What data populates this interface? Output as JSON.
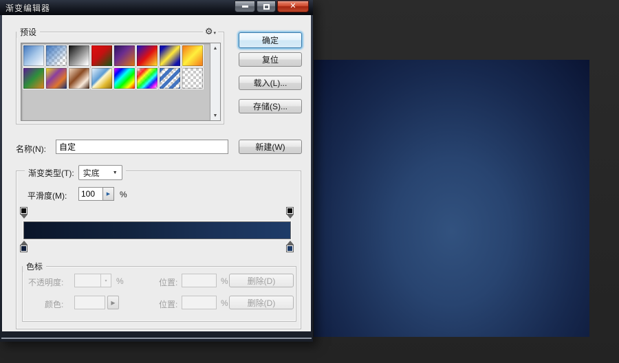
{
  "window": {
    "title": "渐变编辑器",
    "minimize_icon": "",
    "maximize_icon": "",
    "close_icon": "✕"
  },
  "background": {
    "canvas_css": "radial-gradient(ellipse at 50% 62%, #32527f 0%, #284470 30%, #17294f 66%, #0a1433 100%)"
  },
  "presets": {
    "label": "预设",
    "gear_icon": "⚙",
    "gear_menu_arrow": "▾",
    "scroll_up_icon": "▲",
    "scroll_down_icon": "▼",
    "items": [
      {
        "id": "fg-to-bg",
        "css": "linear-gradient(135deg,#3d74bd 0%,#a6c6e8 50%,#ffffff 100%)"
      },
      {
        "id": "fg-to-transparent",
        "css": "linear-gradient(135deg,rgba(61,116,189,1) 0%,rgba(97,146,205,0.6) 45%,rgba(255,255,255,0) 80%),linear-gradient(45deg,#c9c9c9 25%,transparent 25%,transparent 75%,#c9c9c9 75%) 0 0/8px 8px,linear-gradient(45deg,#c9c9c9 25%,transparent 25%,transparent 75%,#c9c9c9 75%) 4px 4px/8px 8px,#fff"
      },
      {
        "id": "black-to-white",
        "css": "linear-gradient(135deg,#0a0a0a 0%,#f8f8f8 90%)"
      },
      {
        "id": "red-to-green",
        "css": "linear-gradient(135deg,#e30e0e 0%,#c41111 45%,#0f5a14 100%)"
      },
      {
        "id": "violet-to-orange",
        "css": "linear-gradient(135deg,#27135f 0%,#6b2d8f 40%,#e0760f 100%)"
      },
      {
        "id": "blue-red-yellow",
        "css": "linear-gradient(135deg,#1212c8 0%,#e01111 52%,#ffec30 100%)"
      },
      {
        "id": "blue-yellow-blue",
        "css": "linear-gradient(135deg,#1111ae 15%,#ffe83a 50%,#1111ae 85%)"
      },
      {
        "id": "orange-yellow-orange",
        "css": "linear-gradient(135deg,#f68b1f 10%,#ffef3c 50%,#f68b1f 90%)"
      },
      {
        "id": "violet-green-orange",
        "css": "linear-gradient(135deg,#5c1a96 0%,#2e8f3c 50%,#e0821c 100%)"
      },
      {
        "id": "yellow-violet-orange-blue",
        "css": "linear-gradient(135deg,#f2df1d 0%,#8a3f9e 38%,#df752c 68%,#123079 100%)"
      },
      {
        "id": "copper",
        "css": "linear-gradient(135deg,#f6dfc9 0%,#8c4c24 42%,#f9e9da 72%,#401f0e 100%)"
      },
      {
        "id": "chrome",
        "css": "linear-gradient(135deg,#edf6fe 0%,#5c9cd4 42%,#fdf7d0 50%,#e3bb32 72%,#8f6c10 100%)"
      },
      {
        "id": "spectrum",
        "css": "linear-gradient(135deg,#ff00ff 0%,#0000ff 20%,#00ffff 40%,#00ff00 60%,#ffff00 80%,#ff0000 100%)"
      },
      {
        "id": "transparent-rainbow",
        "css": "linear-gradient(135deg,rgba(255,255,255,0) 2%,rgba(255,0,0,0.85) 22%,rgba(255,255,0,0.85) 36%,rgba(0,255,0,0.85) 50%,rgba(0,255,255,0.85) 62%,rgba(0,0,255,0.85) 74%,rgba(255,0,255,0.85) 86%,rgba(255,255,255,0) 98%),linear-gradient(45deg,#c9c9c9 25%,transparent 25%,transparent 75%,#c9c9c9 75%) 0 0/8px 8px,linear-gradient(45deg,#c9c9c9 25%,transparent 25%,transparent 75%,#c9c9c9 75%) 4px 4px/8px 8px,#fff"
      },
      {
        "id": "transparent-stripes",
        "css": "repeating-linear-gradient(135deg,rgba(58,110,190,0.95) 0px,rgba(58,110,190,0.95) 5px,rgba(255,255,255,0) 5px,rgba(255,255,255,0) 10px),linear-gradient(45deg,#c9c9c9 25%,transparent 25%,transparent 75%,#c9c9c9 75%) 0 0/8px 8px,linear-gradient(45deg,#c9c9c9 25%,transparent 25%,transparent 75%,#c9c9c9 75%) 4px 4px/8px 8px,#fff"
      },
      {
        "id": "noise-sample",
        "css": "linear-gradient(45deg,#c9c9c9 25%,transparent 25%,transparent 75%,#c9c9c9 75%) 0 0/8px 8px,linear-gradient(45deg,#c9c9c9 25%,transparent 25%,transparent 75%,#c9c9c9 75%) 4px 4px/8px 8px,#fff"
      }
    ]
  },
  "actions": {
    "ok": "确定",
    "reset": "复位",
    "load": "载入(L)...",
    "save": "存储(S)..."
  },
  "name_row": {
    "label": "名称(N):",
    "value": "自定",
    "new_button": "新建(W)"
  },
  "gradient": {
    "type_label": "渐变类型(T):",
    "type_value": "实底",
    "type_dropdown_icon": "▼",
    "smooth_label": "平滑度(M):",
    "smooth_value": "100",
    "smooth_spin_icon": "▶",
    "percent": "%",
    "bar_css": "linear-gradient(90deg,#0a1529 0%,#12243f 40%,#1a3157 70%,#1e3c69 100%)",
    "stops": {
      "opacity_left_color": "#0c0c0c",
      "opacity_right_color": "#0c0c0c",
      "color_left_color": "#0e1d3a",
      "color_right_color": "#1d3a66"
    }
  },
  "stops_panel": {
    "label": "色标",
    "opacity_label": "不透明度:",
    "opacity_value": "",
    "combo_arrow_icon": "▾",
    "color_label": "颜色:",
    "picker_arrow_icon": "▶",
    "position_label": "位置:",
    "position_value": "",
    "percent": "%",
    "delete_label": "删除(D)"
  }
}
